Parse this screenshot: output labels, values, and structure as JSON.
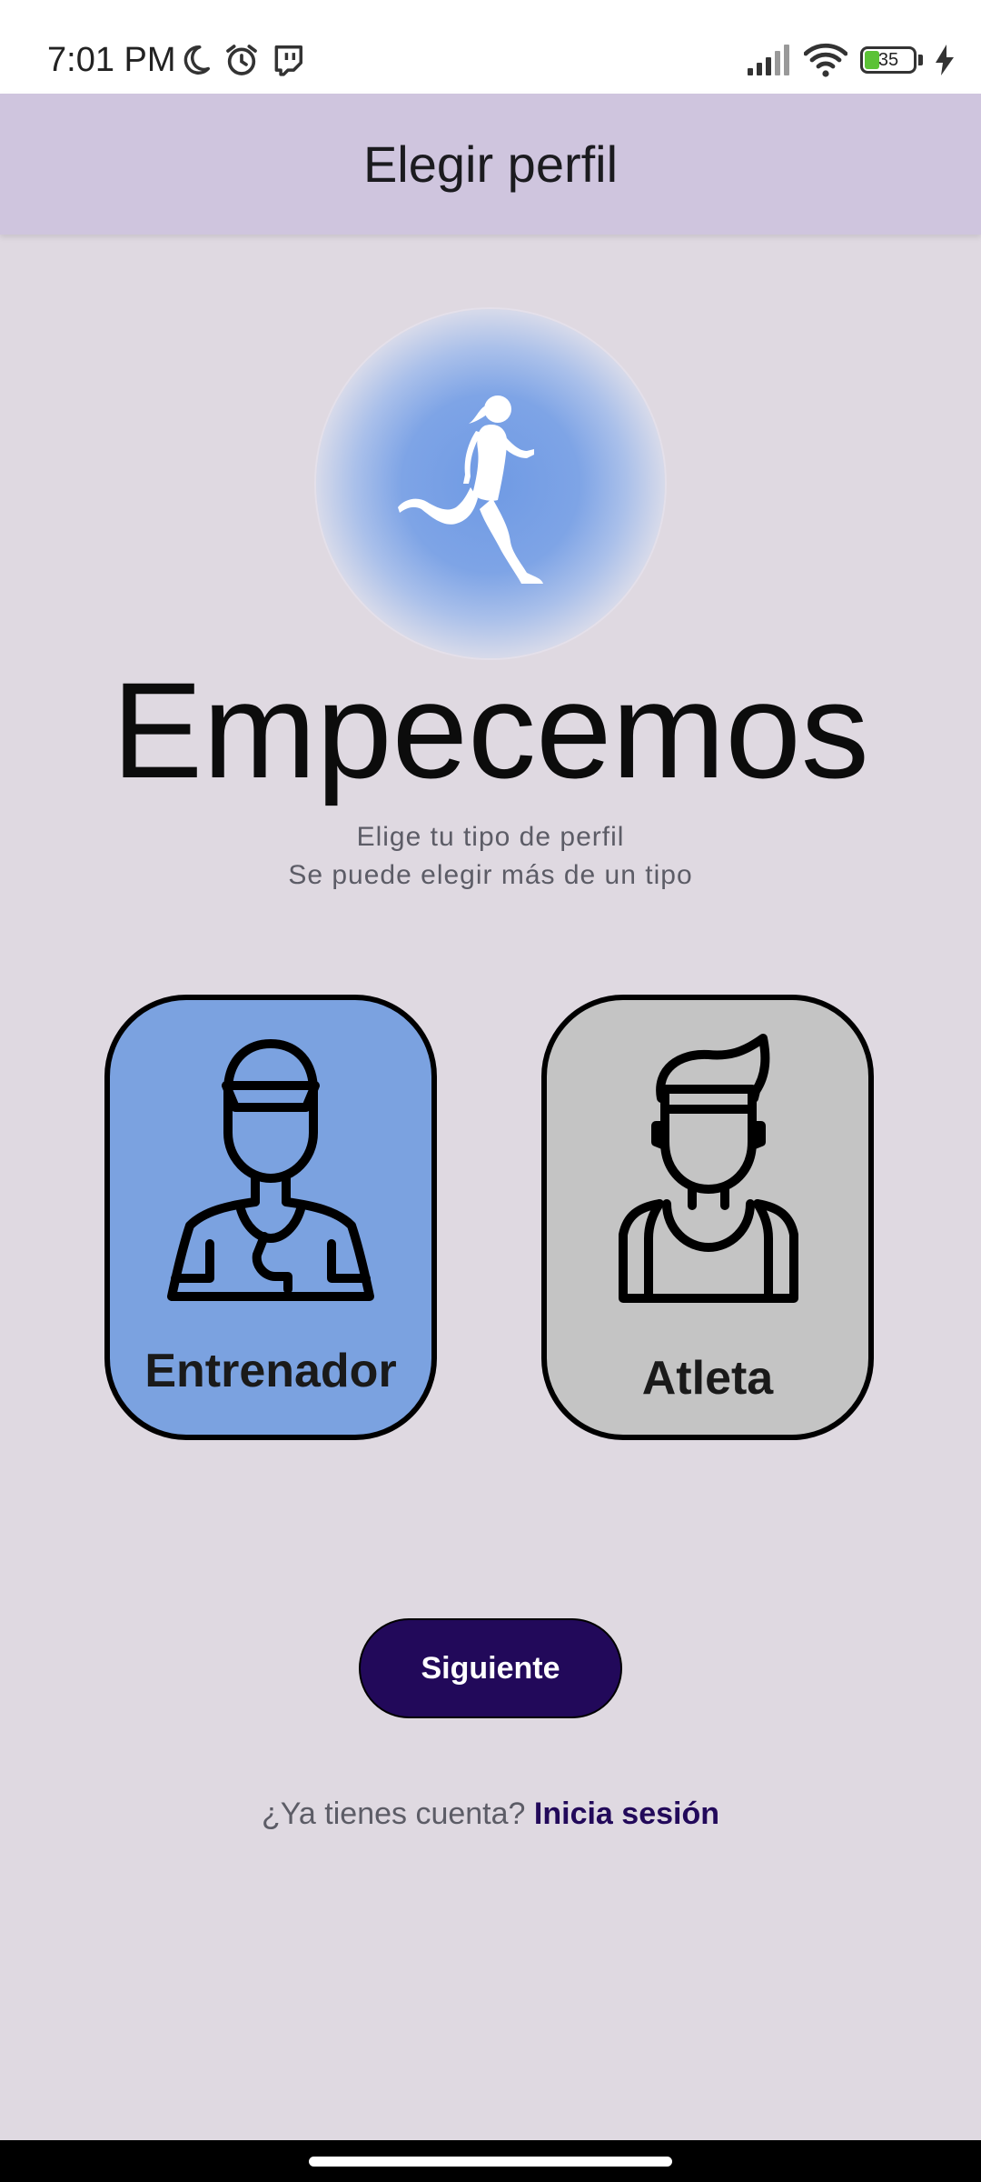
{
  "status_bar": {
    "time": "7:01 PM",
    "left_icons": [
      "moon-icon",
      "alarm-icon",
      "twitch-icon"
    ],
    "right_icons": [
      "signal-icon",
      "wifi-icon",
      "battery-icon",
      "charging-icon"
    ],
    "battery_level": "35"
  },
  "app_bar": {
    "title": "Elegir perfil",
    "background": "#cfc5de"
  },
  "hero": {
    "icon": "runner-icon",
    "headline": "Empecemos",
    "subtitle_line1": "Elige tu tipo de perfil",
    "subtitle_line2": "Se puede elegir más de un tipo"
  },
  "profiles": [
    {
      "label": "Entrenador",
      "icon": "coach-icon",
      "selected": true,
      "color": "#7ba2e0"
    },
    {
      "label": "Atleta",
      "icon": "athlete-icon",
      "selected": false,
      "color": "#c4c4c4"
    }
  ],
  "next_button": {
    "label": "Siguiente",
    "color": "#22095a"
  },
  "login": {
    "prompt": "¿Ya tienes cuenta?",
    "link": "Inicia sesión"
  },
  "colors": {
    "background": "#dfd9e1",
    "accent": "#22095a"
  }
}
